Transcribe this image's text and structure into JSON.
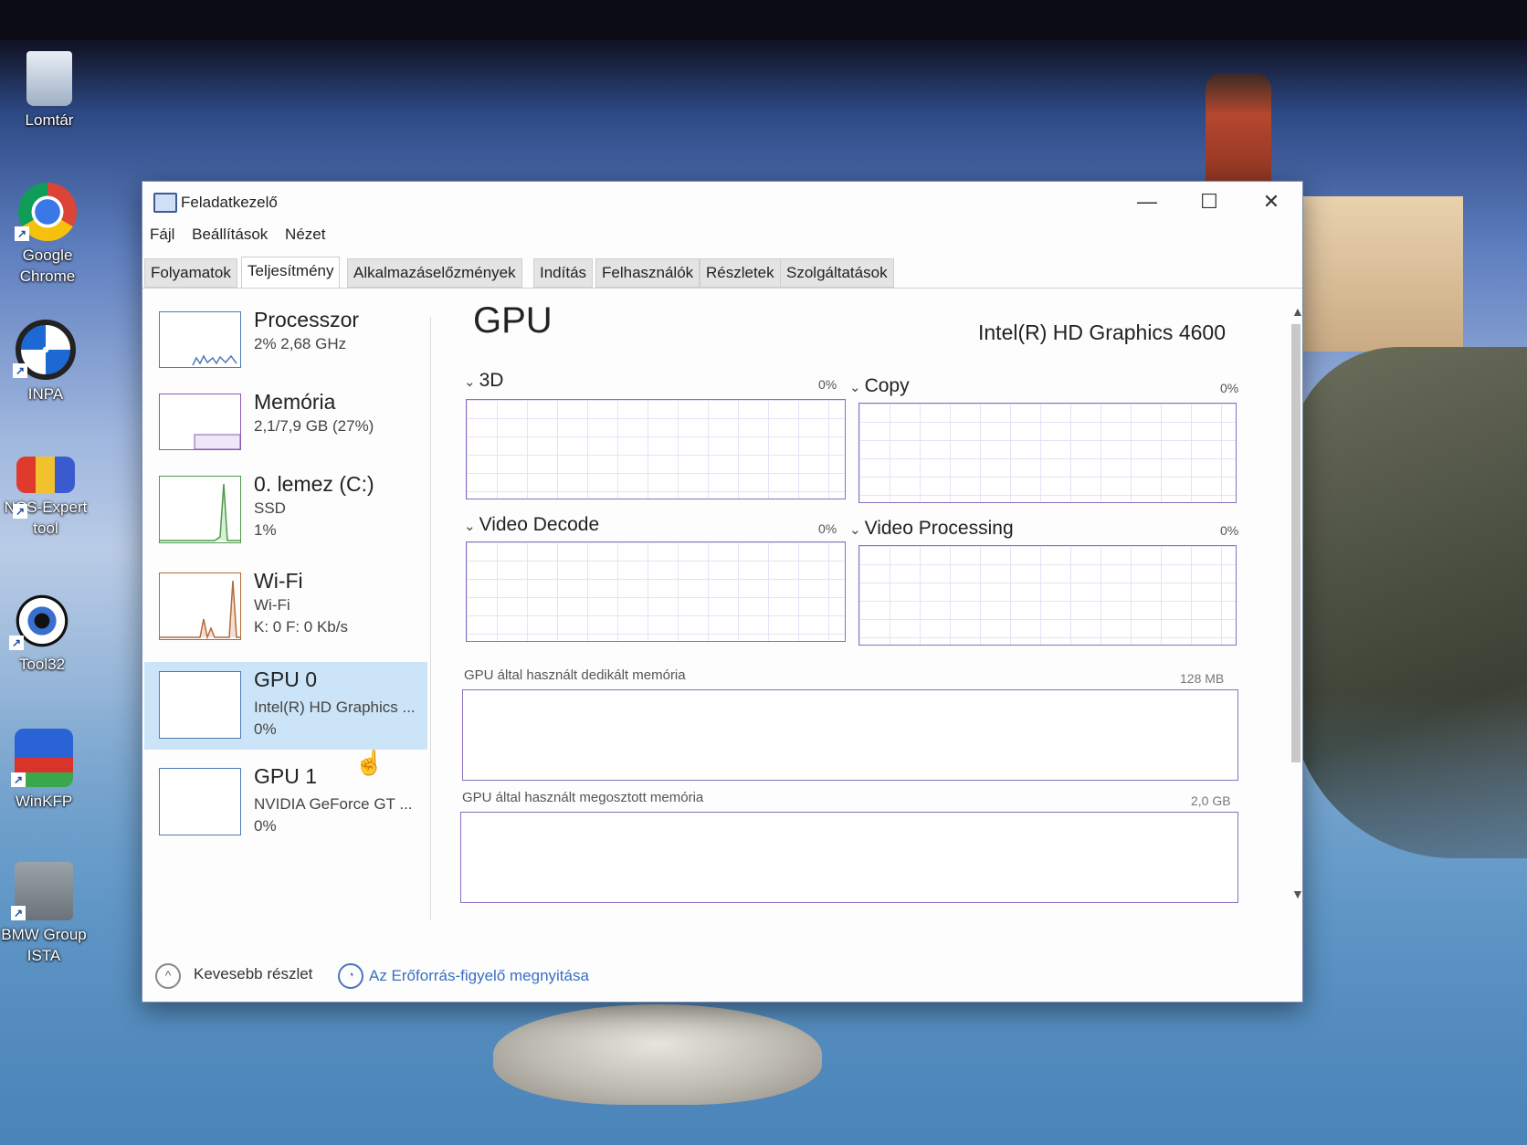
{
  "desktop": {
    "icons": [
      {
        "label": "Lomtár",
        "icon": "recycle-bin-icon"
      },
      {
        "label": "Google Chrome",
        "icon": "chrome-icon"
      },
      {
        "label": "INPA",
        "icon": "bmw-icon"
      },
      {
        "label": "NCS-Expert tool",
        "icon": "ncs-expert-icon"
      },
      {
        "label": "Tool32",
        "icon": "eye-icon"
      },
      {
        "label": "WinKFP",
        "icon": "kfp-icon"
      },
      {
        "label": "BMW Group ISTA",
        "icon": "ista-icon"
      }
    ]
  },
  "window": {
    "title": "Feladatkezelő",
    "controls": {
      "minimize": "—",
      "maximize": "☐",
      "close": "✕"
    }
  },
  "menu": [
    "Fájl",
    "Beállítások",
    "Nézet"
  ],
  "tabs": [
    "Folyamatok",
    "Teljesítmény",
    "Alkalmazáselőzmények",
    "Indítás",
    "Felhasználók",
    "Részletek",
    "Szolgáltatások"
  ],
  "active_tab": "Teljesítmény",
  "sidebar": [
    {
      "name": "Processzor",
      "line1": "2% 2,68 GHz",
      "line2": ""
    },
    {
      "name": "Memória",
      "line1": "2,1/7,9 GB (27%)",
      "line2": ""
    },
    {
      "name": "0. lemez (C:)",
      "line1": "SSD",
      "line2": "1%"
    },
    {
      "name": "Wi-Fi",
      "line1": "Wi-Fi",
      "line2": "K: 0 F: 0 Kb/s"
    },
    {
      "name": "GPU 0",
      "line1": "Intel(R) HD Graphics ...",
      "line2": "0%",
      "selected": true
    },
    {
      "name": "GPU 1",
      "line1": "NVIDIA GeForce GT ...",
      "line2": "0%"
    }
  ],
  "main": {
    "title": "GPU",
    "model": "Intel(R) HD Graphics 4600",
    "engines": [
      {
        "label": "3D",
        "pct": "0%"
      },
      {
        "label": "Copy",
        "pct": "0%"
      },
      {
        "label": "Video Decode",
        "pct": "0%"
      },
      {
        "label": "Video Processing",
        "pct": "0%"
      }
    ],
    "dedicated": {
      "label": "GPU által használt dedikált memória",
      "max": "128 MB"
    },
    "shared": {
      "label": "GPU által használt megosztott memória",
      "max": "2,0 GB"
    }
  },
  "footer": {
    "fewer": "Kevesebb részlet",
    "resmon": "Az Erőforrás-figyelő megnyitása"
  },
  "colors": {
    "selected": "#cce4f7",
    "graph_border": "#8a6fbf",
    "link": "#3a6fc0"
  }
}
